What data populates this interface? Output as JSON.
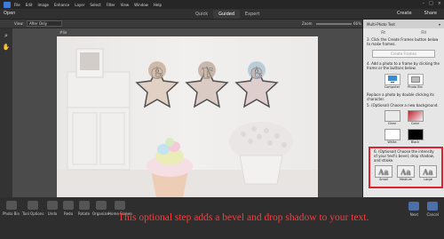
{
  "menubar": {
    "items": [
      "File",
      "Edit",
      "Image",
      "Enhance",
      "Layer",
      "Select",
      "Filter",
      "View",
      "Window",
      "Help"
    ],
    "window_controls": [
      "–",
      "□",
      "×"
    ]
  },
  "modebar": {
    "open_label": "Open",
    "tabs": [
      "Quick",
      "Guided",
      "Expert"
    ],
    "active_tab": "Guided",
    "create_label": "Create",
    "share_label": "Share"
  },
  "options": {
    "view_label": "View:",
    "view_value": "After Only",
    "zoom_label": "Zoom",
    "zoom_value": "66%"
  },
  "canvas": {
    "file_tab": "#4e"
  },
  "panel": {
    "title": "Multi-Photo Text",
    "fit_label_1": "Fit",
    "fit_label_2": "Fill",
    "step3": "3. Click the Create Frames button below to make frames.",
    "create_frames_label": "Create Frames",
    "step4": "4. Add a photo to a frame by clicking the frame or the buttons below.",
    "computer_label": "Computer",
    "photo_bin_label": "Photo Bin",
    "replace_text": "Replace a photo by double clicking its character.",
    "step5": "5. (Optional) Choose a new background.",
    "clear_label": "Clear",
    "color_label": "Color",
    "white_label": "White",
    "black_label": "Black",
    "step6": "6. (Optional) Choose the intensity of your text's bevel, drop shadow, and stroke.",
    "style_glyph": "Aa",
    "small_label": "Small",
    "medium_label": "Medium",
    "large_label": "Large"
  },
  "bottombar": {
    "photo_bin_label": "Photo Bin",
    "tool_options_label": "Tool Options",
    "undo_label": "Undo",
    "redo_label": "Redo",
    "rotate_label": "Rotate",
    "organizer_label": "Organizer",
    "home_screen_label": "Home Screen",
    "next_label": "Next",
    "cancel_label": "Cancel",
    "caption": "This optional step adds a bevel and drop shadow to your text."
  },
  "colors": {
    "accent_red": "#e0202c",
    "caption_red": "#ff3a3a",
    "panel_bg": "#e6e6e6"
  }
}
